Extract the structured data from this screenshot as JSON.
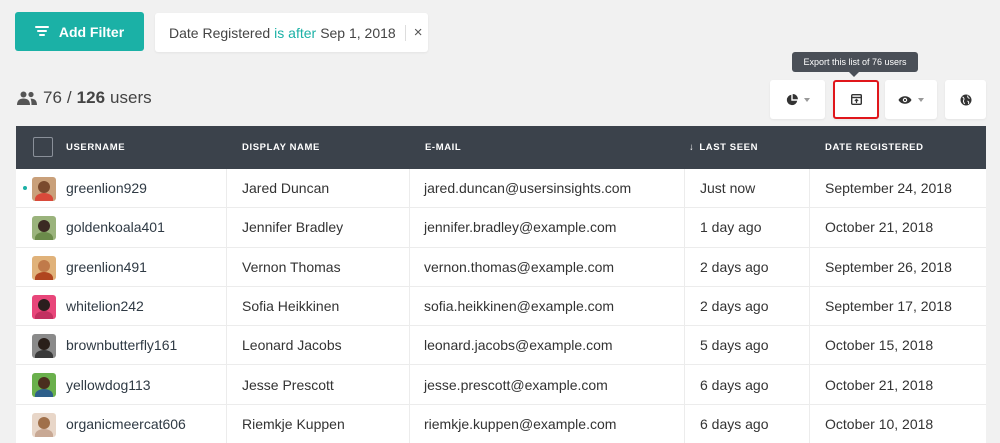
{
  "toolbar": {
    "add_filter_label": "Add Filter",
    "filter": {
      "field": "Date Registered",
      "operator": "is after",
      "value": "Sep 1, 2018",
      "close": "×"
    },
    "tooltip": "Export this list of 76 users"
  },
  "users_count": {
    "filtered": "76",
    "separator": "/",
    "total": "126",
    "suffix": "users"
  },
  "table": {
    "columns": {
      "username": "USERNAME",
      "display_name": "DISPLAY NAME",
      "email": "E-MAIL",
      "last_seen_arrow": "↓",
      "last_seen": "LAST SEEN",
      "date_registered": "DATE REGISTERED"
    },
    "rows": [
      {
        "username": "greenlion929",
        "display_name": "Jared Duncan",
        "email": "jared.duncan@usersinsights.com",
        "last_seen": "Just now",
        "date_registered": "September 24, 2018",
        "online": true,
        "avatar_bg": "#c9a07a",
        "avatar_head": "#7a4a2e",
        "avatar_body": "#d94a3a"
      },
      {
        "username": "goldenkoala401",
        "display_name": "Jennifer Bradley",
        "email": "jennifer.bradley@example.com",
        "last_seen": "1 day ago",
        "date_registered": "October 21, 2018",
        "online": false,
        "avatar_bg": "#9ab37c",
        "avatar_head": "#3b2a22",
        "avatar_body": "#6b8b4a"
      },
      {
        "username": "greenlion491",
        "display_name": "Vernon Thomas",
        "email": "vernon.thomas@example.com",
        "last_seen": "2 days ago",
        "date_registered": "September 26, 2018",
        "online": false,
        "avatar_bg": "#e0b27a",
        "avatar_head": "#c07a4a",
        "avatar_body": "#b0451f"
      },
      {
        "username": "whitelion242",
        "display_name": "Sofia Heikkinen",
        "email": "sofia.heikkinen@example.com",
        "last_seen": "2 days ago",
        "date_registered": "September 17, 2018",
        "online": false,
        "avatar_bg": "#e8467a",
        "avatar_head": "#2b1e1e",
        "avatar_body": "#c23060"
      },
      {
        "username": "brownbutterfly161",
        "display_name": "Leonard Jacobs",
        "email": "leonard.jacobs@example.com",
        "last_seen": "5 days ago",
        "date_registered": "October 15, 2018",
        "online": false,
        "avatar_bg": "#8a8a8a",
        "avatar_head": "#2a1f1a",
        "avatar_body": "#3a3a3a"
      },
      {
        "username": "yellowdog113",
        "display_name": "Jesse Prescott",
        "email": "jesse.prescott@example.com",
        "last_seen": "6 days ago",
        "date_registered": "October 21, 2018",
        "online": false,
        "avatar_bg": "#6ab04c",
        "avatar_head": "#4a2e1e",
        "avatar_body": "#2e5f8a"
      },
      {
        "username": "organicmeercat606",
        "display_name": "Riemkje Kuppen",
        "email": "riemkje.kuppen@example.com",
        "last_seen": "6 days ago",
        "date_registered": "October 10, 2018",
        "online": false,
        "avatar_bg": "#e8d6c8",
        "avatar_head": "#a0704a",
        "avatar_body": "#c8a894"
      }
    ]
  },
  "icons": {
    "filter": "filter-icon",
    "users": "users-icon",
    "segments": "pie-chart-icon",
    "export": "export-icon",
    "columns": "eye-icon",
    "map": "globe-icon"
  },
  "colors": {
    "accent": "#1bb1a6",
    "header_bg": "#3b424b",
    "highlight": "#e0161b"
  }
}
